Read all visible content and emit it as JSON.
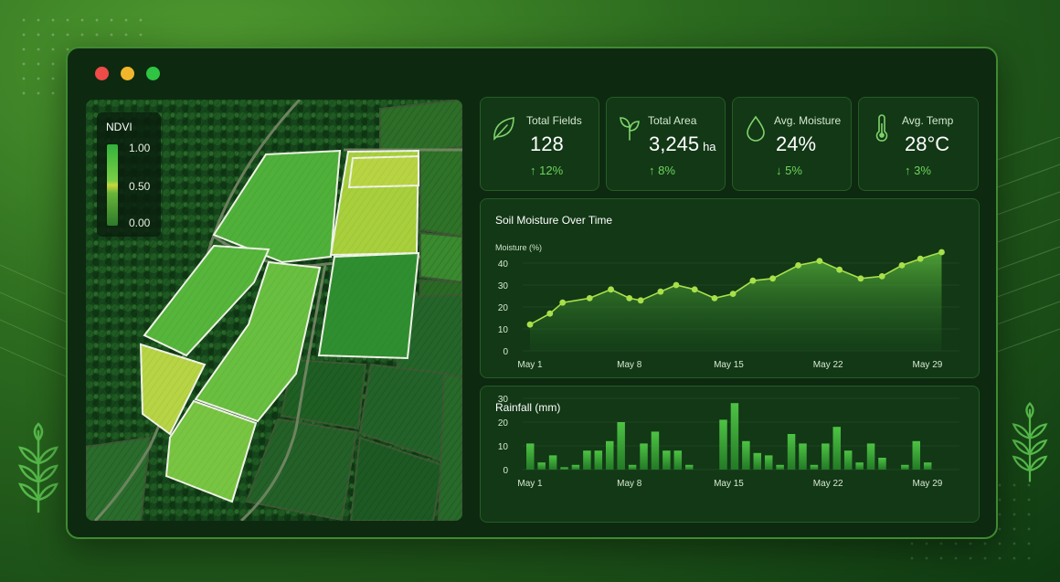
{
  "window": {
    "controls": [
      "close",
      "minimize",
      "maximize"
    ]
  },
  "map": {
    "legend": {
      "title": "NDVI",
      "max_label": "1.00",
      "mid_label": "0.50",
      "min_label": "0.00"
    }
  },
  "stats": [
    {
      "icon": "leaf-icon",
      "label": "Total Fields",
      "value": "128",
      "unit": "",
      "delta": "12%",
      "direction": "up"
    },
    {
      "icon": "sprout-icon",
      "label": "Total Area",
      "value": "3,245",
      "unit": "ha",
      "delta": "8%",
      "direction": "up"
    },
    {
      "icon": "water-drop-icon",
      "label": "Avg. Moisture",
      "value": "24%",
      "unit": "",
      "delta": "5%",
      "direction": "down"
    },
    {
      "icon": "thermometer-icon",
      "label": "Avg. Temp",
      "value": "28°C",
      "unit": "",
      "delta": "3%",
      "direction": "up"
    }
  ],
  "charts_text": {
    "moisture_title": "Soil Moisture Over Time",
    "moisture_ylabel": "Moisture (%)",
    "rainfall_title": "Rainfall (mm)"
  },
  "colors": {
    "accent": "#6fd35c",
    "line": "#a8e04a",
    "bar": "#3fae3a"
  },
  "chart_data": [
    {
      "type": "area",
      "title": "Soil Moisture Over Time",
      "ylabel": "Moisture (%)",
      "ylim": [
        0,
        40
      ],
      "yticks": [
        0,
        10,
        20,
        30,
        40
      ],
      "xlim": [
        1,
        31
      ],
      "xticks": [
        1,
        8,
        15,
        22,
        29
      ],
      "xtick_labels": [
        "May 1",
        "May 8",
        "May 15",
        "May 22",
        "May 29"
      ],
      "x": [
        1,
        2.4,
        3.3,
        5.2,
        6.7,
        8,
        8.8,
        10.2,
        11.3,
        12.6,
        14,
        15.3,
        16.7,
        18.1,
        19.9,
        21.4,
        22.8,
        24.3,
        25.8,
        27.2,
        28.5,
        30
      ],
      "y": [
        12,
        17,
        22,
        24,
        28,
        24,
        23,
        27,
        30,
        28,
        24,
        26,
        32,
        33,
        39,
        41,
        37,
        33,
        34,
        39,
        42,
        45
      ]
    },
    {
      "type": "bar",
      "title": "Rainfall (mm)",
      "ylim": [
        0,
        30
      ],
      "yticks": [
        0,
        10,
        20,
        30
      ],
      "xticks": [
        1,
        8,
        15,
        22,
        29
      ],
      "xtick_labels": [
        "May 1",
        "May 8",
        "May 15",
        "May 22",
        "May 29"
      ],
      "x": [
        1,
        1.8,
        2.6,
        3.4,
        4.2,
        5,
        5.8,
        6.6,
        7.4,
        8.2,
        9,
        9.8,
        10.6,
        11.4,
        12.2,
        14.6,
        15.4,
        16.2,
        17,
        17.8,
        18.6,
        19.4,
        20.2,
        21,
        21.8,
        22.6,
        23.4,
        24.2,
        25,
        25.8,
        27.4,
        28.2,
        29
      ],
      "values": [
        11,
        3,
        6,
        1,
        2,
        8,
        8,
        12,
        20,
        2,
        11,
        16,
        8,
        8,
        2,
        21,
        28,
        12,
        7,
        6,
        2,
        15,
        11,
        2,
        11,
        18,
        8,
        3,
        11,
        5,
        2,
        12,
        3
      ]
    }
  ]
}
